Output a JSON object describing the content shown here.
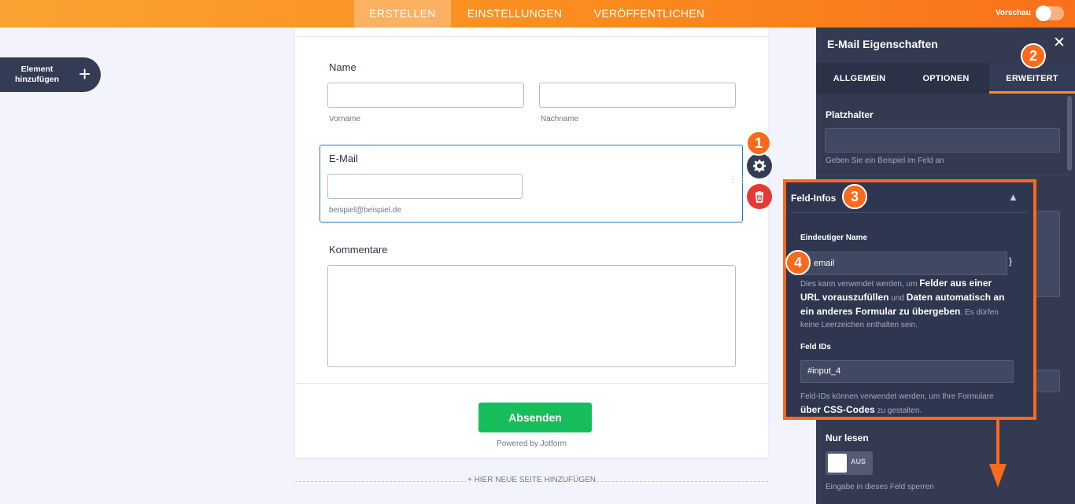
{
  "topbar": {
    "tabs": [
      {
        "label": "ERSTELLEN",
        "active": true
      },
      {
        "label": "EINSTELLUNGEN",
        "active": false
      },
      {
        "label": "VERÖFFENTLICHEN",
        "active": false
      }
    ],
    "preview_label": "Vorschau",
    "preview_on": false
  },
  "sidebar": {
    "add_element_line1": "Element",
    "add_element_line2": "hinzufügen",
    "add_icon": "plus-icon"
  },
  "form": {
    "name_label": "Name",
    "first_name_sublabel": "Vorname",
    "last_name_sublabel": "Nachname",
    "email_label": "E-Mail",
    "email_sublabel": "beispiel@beispiel.de",
    "comments_label": "Kommentare",
    "submit_label": "Absenden",
    "powered_by": "Powered by Jotform",
    "add_page_label": "+ HIER NEUE SEITE HINZUFÜGEN"
  },
  "panel": {
    "title": "E-Mail Eigenschaften",
    "close_icon": "close-icon",
    "tabs": [
      {
        "label": "ALLGEMEIN",
        "active": false
      },
      {
        "label": "OPTIONEN",
        "active": false
      },
      {
        "label": "ERWEITERT",
        "active": true
      }
    ],
    "placeholder_label": "Platzhalter",
    "placeholder_value": "",
    "placeholder_hint": "Geben Sie ein Beispiel im Feld an",
    "field_info": {
      "title": "Feld-Infos",
      "unique_name_label": "Eindeutiger Name",
      "unique_name_value": "email",
      "brace": "}",
      "desc_1": "Dies kann verwendet werden, um ",
      "desc_2": "Felder aus einer URL vorauszufüllen",
      "desc_3": " und ",
      "desc_4": "Daten automatisch an ein anderes Formular zu übergeben",
      "desc_5": ". Es dürfen keine Leerzeichen enthalten sein.",
      "field_ids_label": "Feld IDs",
      "field_ids_value": "#input_4",
      "ids_desc_1": "Feld-IDs können verwendet werden, um Ihre Formulare ",
      "ids_desc_2": "über CSS-Codes",
      "ids_desc_3": " zu gestalten."
    },
    "readonly_label": "Nur lesen",
    "readonly_state": "AUS",
    "readonly_hint": "Eingabe in dieses Feld sperren"
  },
  "annotations": {
    "badge_1": "1",
    "badge_2": "2",
    "badge_3": "3",
    "badge_4": "4",
    "color": "#fb6a1a"
  }
}
